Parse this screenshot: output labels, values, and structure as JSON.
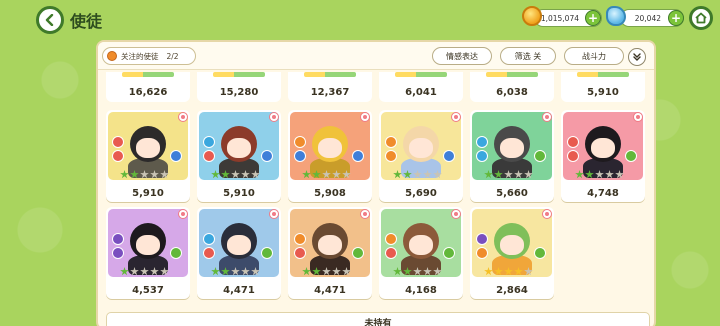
{
  "header": {
    "title": "使徒",
    "currency": [
      {
        "name": "coin",
        "value": "1,015,074"
      },
      {
        "name": "leaf",
        "value": "20,042"
      }
    ]
  },
  "filters": {
    "favorite_label": "关注的使徒",
    "favorite_count": "2/2",
    "emotion_label": "情感表达",
    "filter_label": "筛选 关",
    "power_label": "战斗力"
  },
  "top_row": [
    "16,626",
    "15,280",
    "12,367",
    "6,041",
    "6,038",
    "5,910"
  ],
  "cards": [
    {
      "power": "5,910",
      "bg": "#f4e38a",
      "hair": "#2c2a2a",
      "outfit": "#5e5a4c",
      "stars": [
        "green",
        "green",
        "gray",
        "gray",
        "gray"
      ],
      "elem1": "#e85a4f",
      "elem2": "#e85a4f",
      "role": "#3f7fd9"
    },
    {
      "power": "5,910",
      "bg": "#8fd0ea",
      "hair": "#8c3b2a",
      "outfit": "#3d3a37",
      "stars": [
        "green",
        "green",
        "gray",
        "gray",
        "gray"
      ],
      "elem1": "#3aa7de",
      "elem2": "#e85a4f",
      "role": "#3f7fd9"
    },
    {
      "power": "5,908",
      "bg": "#f5a27a",
      "hair": "#f0c23a",
      "outfit": "#c99d2a",
      "stars": [
        "green",
        "green",
        "gray",
        "gray",
        "gray"
      ],
      "elem1": "#f08c2b",
      "elem2": "#3f7fd9",
      "role": "#3f7fd9"
    },
    {
      "power": "5,690",
      "bg": "#f7e69a",
      "hair": "#f4d7a8",
      "outfit": "#a9c4e8",
      "stars": [
        "green",
        "green",
        "gray",
        "gray",
        "gray"
      ],
      "elem1": "#f08c2b",
      "elem2": "#f08c2b",
      "role": "#3f7fd9"
    },
    {
      "power": "5,660",
      "bg": "#7fd39a",
      "hair": "#4a4a4a",
      "outfit": "#3a3a3a",
      "stars": [
        "green",
        "green",
        "gray",
        "gray",
        "gray"
      ],
      "elem1": "#3aa7de",
      "elem2": "#3aa7de",
      "role": "#62b83a"
    },
    {
      "power": "4,748",
      "bg": "#f59aa6",
      "hair": "#1e1a1e",
      "outfit": "#2a2530",
      "stars": [
        "green",
        "green",
        "gray",
        "gray",
        "gray"
      ],
      "elem1": "#e85a4f",
      "elem2": "#e85a4f",
      "role": "#62b83a"
    },
    {
      "power": "4,537",
      "bg": "#d6a8e8",
      "hair": "#1e1a1e",
      "outfit": "#2a2530",
      "stars": [
        "green",
        "gray",
        "gray",
        "gray",
        "gray"
      ],
      "elem1": "#7a4fbf",
      "elem2": "#7a4fbf",
      "role": "#62b83a"
    },
    {
      "power": "4,471",
      "bg": "#9fc9ea",
      "hair": "#2a2d3a",
      "outfit": "#3d4b6a",
      "stars": [
        "green",
        "green",
        "gray",
        "gray",
        "gray"
      ],
      "elem1": "#3aa7de",
      "elem2": "#e85a4f",
      "role": "#62b83a"
    },
    {
      "power": "4,471",
      "bg": "#f2c08a",
      "hair": "#6a4a32",
      "outfit": "#3a2a22",
      "stars": [
        "green",
        "green",
        "gray",
        "gray",
        "gray"
      ],
      "elem1": "#f08c2b",
      "elem2": "#e85a4f",
      "role": "#62b83a"
    },
    {
      "power": "4,168",
      "bg": "#a8dea0",
      "hair": "#8c5a3a",
      "outfit": "#6a4a32",
      "stars": [
        "green",
        "green",
        "gray",
        "gray",
        "gray"
      ],
      "elem1": "#f08c2b",
      "elem2": "#e85a4f",
      "role": "#62b83a"
    },
    {
      "power": "2,864",
      "bg": "#f7e6a0",
      "hair": "#7fbf5a",
      "outfit": "#f0a63a",
      "stars": [
        "gold",
        "gold",
        "gold",
        "gold",
        "gray"
      ],
      "elem1": "#7a4fbf",
      "elem2": "#f08c2b",
      "role": "#62b83a"
    }
  ],
  "unowned_label": "未持有"
}
